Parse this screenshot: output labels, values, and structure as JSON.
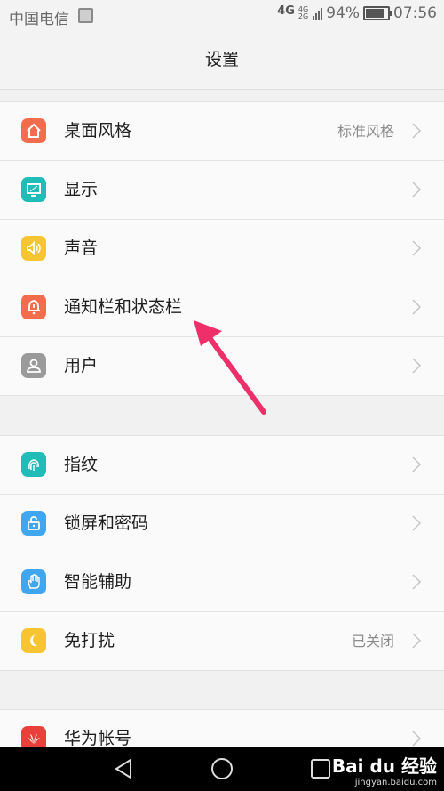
{
  "status": {
    "carrier": "中国电信",
    "network": "4G",
    "network2": "4G",
    "network3": "2G",
    "battery": "94%",
    "time": "07:56"
  },
  "header": {
    "title": "设置"
  },
  "group1": [
    {
      "label": "桌面风格",
      "value": "标准风格",
      "icon": "home-icon",
      "color": "#f26d4e"
    },
    {
      "label": "显示",
      "value": "",
      "icon": "display-icon",
      "color": "#1fbcb8"
    },
    {
      "label": "声音",
      "value": "",
      "icon": "speaker-icon",
      "color": "#f7c531"
    },
    {
      "label": "通知栏和状态栏",
      "value": "",
      "icon": "bell-icon",
      "color": "#f26d4e"
    },
    {
      "label": "用户",
      "value": "",
      "icon": "user-icon",
      "color": "#9a9a9a"
    }
  ],
  "group2": [
    {
      "label": "指纹",
      "value": "",
      "icon": "fingerprint-icon",
      "color": "#1fbcb8"
    },
    {
      "label": "锁屏和密码",
      "value": "",
      "icon": "unlock-icon",
      "color": "#3fa6ef"
    },
    {
      "label": "智能辅助",
      "value": "",
      "icon": "hand-icon",
      "color": "#3fa6ef"
    },
    {
      "label": "免打扰",
      "value": "已关闭",
      "icon": "moon-icon",
      "color": "#f7c531"
    }
  ],
  "group3": [
    {
      "label": "华为帐号",
      "value": "",
      "icon": "huawei-icon",
      "color": "#e8403a"
    }
  ],
  "watermark": {
    "brand": "Bai du 经验",
    "url": "jingyan.baidu.com"
  }
}
